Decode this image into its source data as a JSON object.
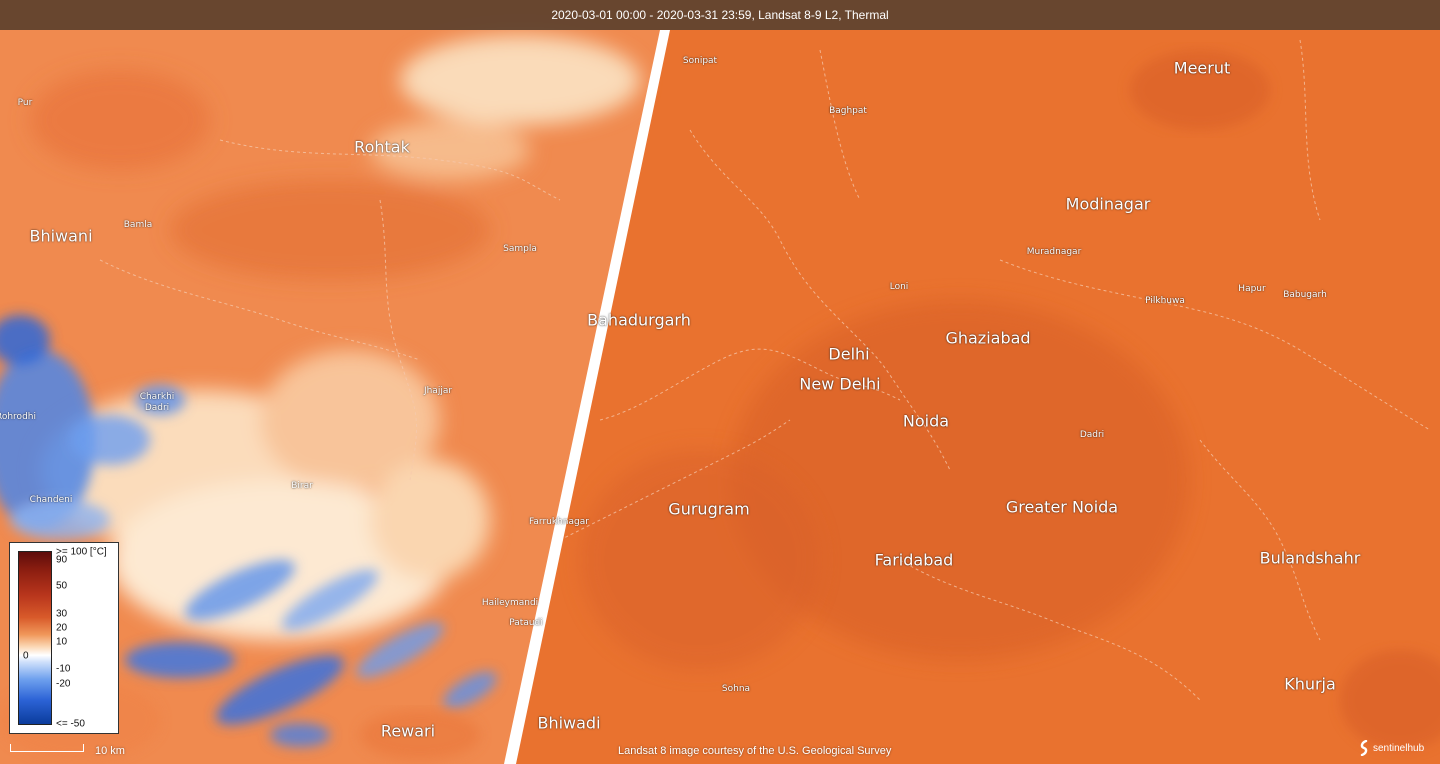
{
  "header": {
    "title": "2020-03-01 00:00 - 2020-03-31 23:59, Landsat 8-9 L2, Thermal"
  },
  "places": {
    "meerut": "Meerut",
    "sonipat": "Sonipat",
    "baghpat": "Baghpat",
    "pur": "Pur",
    "rohtak": "Rohtak",
    "modinagar": "Modinagar",
    "bhiwani": "Bhiwani",
    "bamla": "Bamla",
    "sampla": "Sampla",
    "muradnagar": "Muradnagar",
    "loni": "Loni",
    "hapur": "Hapur",
    "babugarh": "Babugarh",
    "pilkhuwa": "Pilkhuwa",
    "bahadurgarh": "Bahadurgarh",
    "ghaziabad": "Ghaziabad",
    "delhi": "Delhi",
    "new_delhi": "New Delhi",
    "charkhi_dadri": "Charkhi Dadri",
    "jhajjar": "Jhajjar",
    "rohrodhi": "Rohrodhi",
    "noida": "Noida",
    "dadri": "Dadri",
    "birar": "Birar",
    "chandeni": "Chandeni",
    "gurugram": "Gurugram",
    "farrukhnagar": "Farrukhnagar",
    "greater_noida": "Greater Noida",
    "faridabad": "Faridabad",
    "bulandshahr": "Bulandshahr",
    "haileymandi": "Haileymandi",
    "pataudi": "Pataudi",
    "sohna": "Sohna",
    "khurja": "Khurja",
    "rewari": "Rewari",
    "bhiwadi": "Bhiwadi"
  },
  "legend": {
    "ticks": [
      ">= 100 [°C]",
      "90",
      "50",
      "30",
      "20",
      "10",
      "0",
      "-10",
      "-20",
      "<= -50"
    ],
    "colors": [
      "#5e0c0c",
      "#b8351c",
      "#f0975a",
      "#ffffff",
      "#6ea0ee",
      "#0b3c9c"
    ]
  },
  "scale": {
    "label": "10 km"
  },
  "attribution": "Landsat 8 image courtesy of the U.S. Geological Survey",
  "logo": {
    "label": "sentinelhub"
  }
}
